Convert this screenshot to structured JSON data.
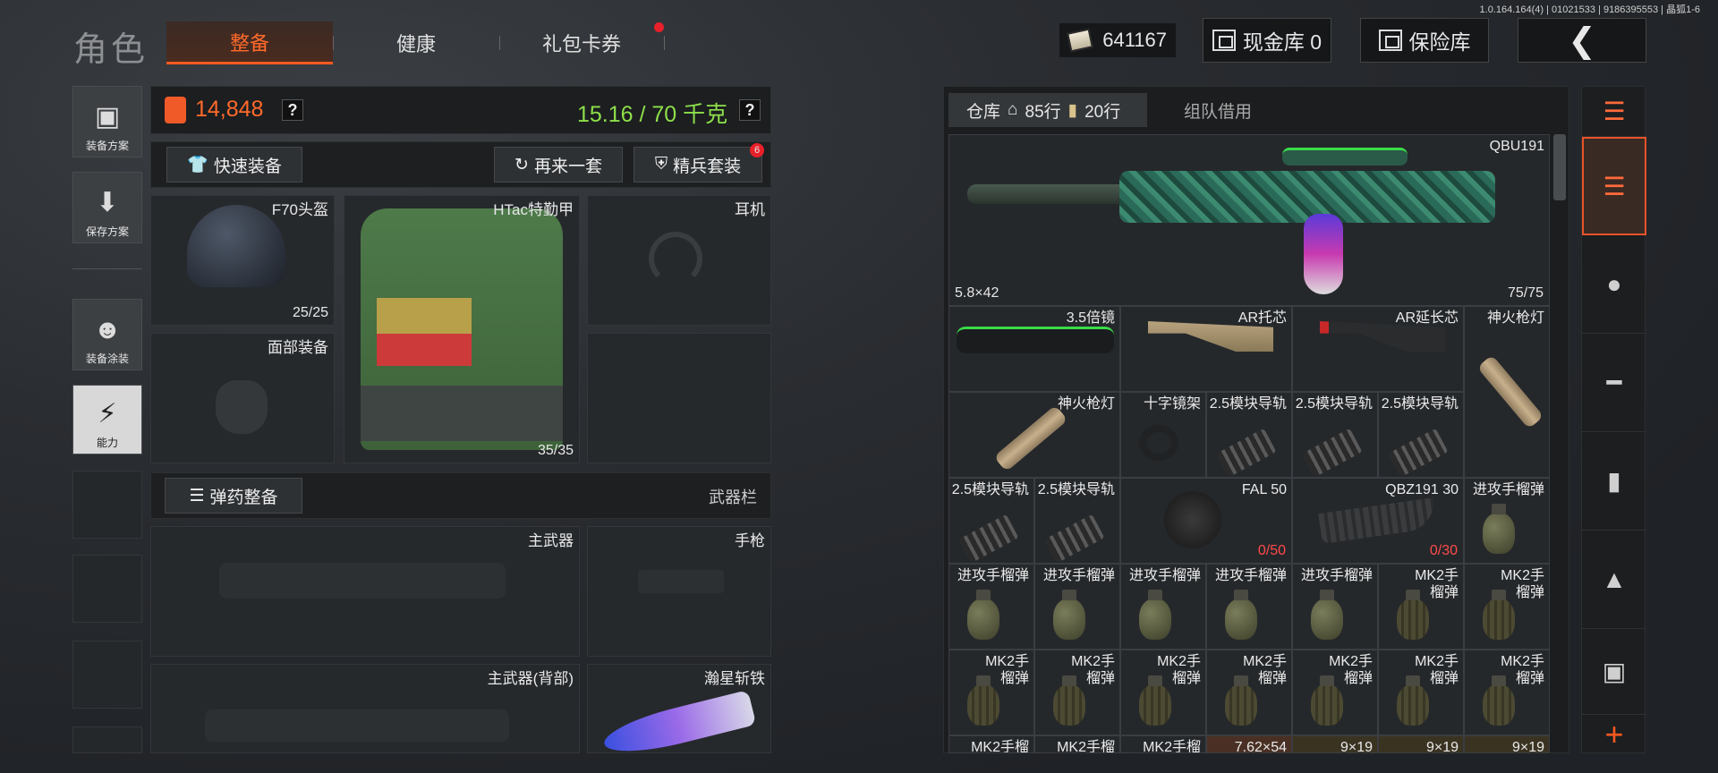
{
  "version": "1.0.164.164(4) | 01021533 | 9186395553 | 晶狐1-6",
  "page_title": "角色",
  "tabs": [
    {
      "label": "整备"
    },
    {
      "label": "健康"
    },
    {
      "label": "礼包卡券"
    }
  ],
  "top": {
    "money": "641167",
    "cash_vault": "现金库 0",
    "insurance": "保险库",
    "back_icon": "chevron-left-icon"
  },
  "left_nav": [
    {
      "label": "装备方案"
    },
    {
      "label": "保存方案"
    },
    {
      "label": "装备涂装"
    },
    {
      "label": "能力"
    }
  ],
  "loadout": {
    "value": "14,848",
    "weight": "15.16 / 70 千克",
    "quick_equip": "快速装备",
    "again": "再来一套",
    "elite_set": "精兵套装",
    "elite_badge": "6",
    "helmet": {
      "name": "F70头盔",
      "dur": "25/25"
    },
    "armor": {
      "name": "HTac特勤甲",
      "dur": "35/35"
    },
    "headset": "耳机",
    "face": "面部装备",
    "ammo_equip": "弹药整备",
    "weapon_bar": "武器栏",
    "primary": "主武器",
    "pistol": "手枪",
    "primary_back": "主武器(背部)",
    "melee": "瀚星斩铁"
  },
  "warehouse": {
    "tab_label": "仓库",
    "rows_home": "85行",
    "rows_ticket": "20行",
    "team_borrow": "组队借用",
    "gun": {
      "name": "QBU191",
      "caliber": "5.8×42",
      "ammo": "75/75"
    },
    "items": [
      {
        "label": "3.5倍镜"
      },
      {
        "label": "AR托芯"
      },
      {
        "label": "AR延长芯"
      },
      {
        "label": "神火枪灯"
      },
      {
        "label": "神火枪灯"
      },
      {
        "label": "十字镜架"
      },
      {
        "label": "2.5模块导轨"
      },
      {
        "label": "2.5模块导轨"
      },
      {
        "label": "2.5模块导轨"
      },
      {
        "label": "2.5模块导轨"
      },
      {
        "label": "2.5模块导轨"
      },
      {
        "label": "FAL 50",
        "count": "0/50"
      },
      {
        "label": "QBZ191 30",
        "count": "0/30"
      },
      {
        "label": "进攻手榴弹"
      },
      {
        "label": "进攻手榴弹"
      },
      {
        "label": "进攻手榴弹"
      },
      {
        "label": "进攻手榴弹"
      },
      {
        "label": "进攻手榴弹"
      },
      {
        "label": "进攻手榴弹"
      },
      {
        "label": "MK2手榴弹"
      },
      {
        "label": "MK2手榴弹"
      },
      {
        "label": "MK2手榴弹"
      },
      {
        "label": "MK2手榴弹"
      },
      {
        "label": "MK2手榴弹"
      },
      {
        "label": "MK2手榴弹"
      },
      {
        "label": "MK2手榴弹"
      },
      {
        "label": "MK2手榴弹"
      },
      {
        "label": "MK2手榴弹"
      },
      {
        "label": "MK2手榴"
      },
      {
        "label": "MK2手榴"
      },
      {
        "label": "MK2手榴"
      },
      {
        "label": "7.62×54"
      },
      {
        "label": "9×19"
      },
      {
        "label": "9×19"
      },
      {
        "label": "9×19"
      }
    ]
  },
  "right_bar": [
    "layers-refresh-icon",
    "layers-icon",
    "helmet-icon",
    "rifle-icon",
    "magazine-icon",
    "bullet-icon",
    "sight-icon",
    "plus-icon"
  ],
  "colors": {
    "accent": "#ff5a1f",
    "weight_green": "#8ee04a"
  }
}
